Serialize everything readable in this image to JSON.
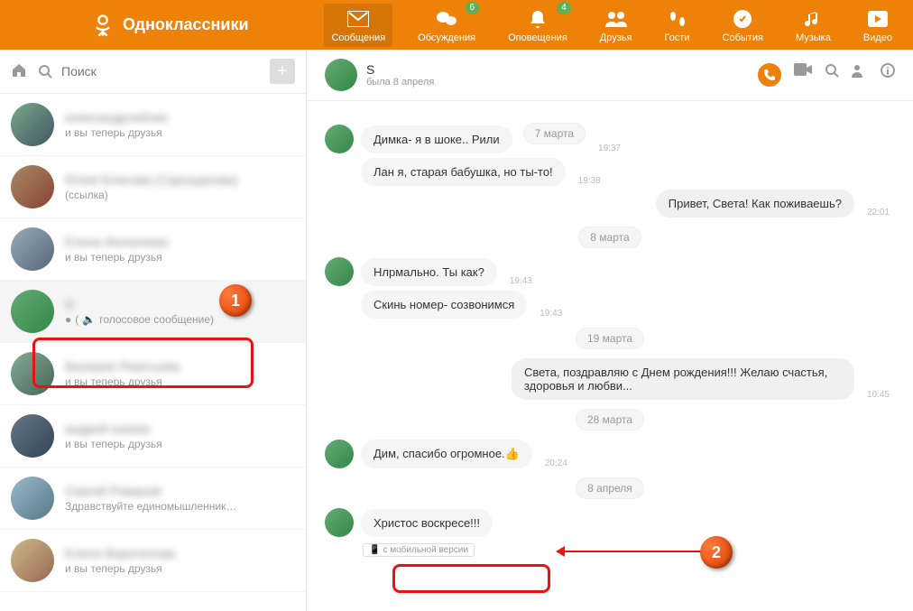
{
  "header": {
    "brand": "Одноклассники",
    "nav": [
      {
        "label": "Сообщения",
        "badge": null,
        "active": true
      },
      {
        "label": "Обсуждения",
        "badge": "6"
      },
      {
        "label": "Оповещения",
        "badge": "4"
      },
      {
        "label": "Друзья",
        "badge": null
      },
      {
        "label": "Гости",
        "badge": null
      },
      {
        "label": "События",
        "badge": null
      },
      {
        "label": "Музыка",
        "badge": null
      },
      {
        "label": "Видео",
        "badge": null
      }
    ]
  },
  "sidebar": {
    "search_placeholder": "Поиск",
    "items": [
      {
        "name": "александрсиблин",
        "snippet": "и вы теперь друзья"
      },
      {
        "name": "Юлия Блинова (Скрощанова)",
        "snippet": "(ссылка)"
      },
      {
        "name": "Елена Фалагяева",
        "snippet": "и вы теперь друзья"
      },
      {
        "name": "S",
        "snippet": "голосовое сообщение)"
      },
      {
        "name": "Валерия Рекитьева",
        "snippet": "и вы теперь друзья"
      },
      {
        "name": "андрей кокиев",
        "snippet": "и вы теперь друзья"
      },
      {
        "name": "Сергей Романов",
        "snippet": "Здравствуйте единомышленник…"
      },
      {
        "name": "Елена Воротилова",
        "snippet": "и вы теперь друзья"
      }
    ]
  },
  "chat": {
    "name": "S",
    "status": "была 8 апреля",
    "messages": [
      {
        "side": "left",
        "text": "Димка- я в шоке.. Рили",
        "time": "19:37",
        "first": true
      },
      {
        "side": "date",
        "text": "7 марта"
      },
      {
        "side": "left",
        "text": "Лан я, старая бабушка, но ты-то!",
        "time": "19:38"
      },
      {
        "side": "right",
        "text": "Привет, Света! Как поживаешь?",
        "time": "22:01"
      },
      {
        "side": "date",
        "text": "8 марта"
      },
      {
        "side": "left",
        "text": "Нлрмально. Ты как?",
        "time": "19:43",
        "first": true
      },
      {
        "side": "left",
        "text": "Скинь номер- созвонимся",
        "time": "19:43"
      },
      {
        "side": "date",
        "text": "19 марта"
      },
      {
        "side": "right",
        "text": "Света, поздравляю с Днем рождения!!! Желаю счастья, здоровья и любви...",
        "time": "10:45"
      },
      {
        "side": "date",
        "text": "28 марта"
      },
      {
        "side": "left",
        "text": "Дим, спасибо огромное.👍",
        "time": "20:24",
        "first": true
      },
      {
        "side": "date",
        "text": "8 апреля"
      },
      {
        "side": "left",
        "text": "Христос воскресе!!!",
        "time": "",
        "first": true
      }
    ],
    "mobile_tag": "с мобильной версии"
  },
  "callouts": {
    "one": "1",
    "two": "2"
  }
}
